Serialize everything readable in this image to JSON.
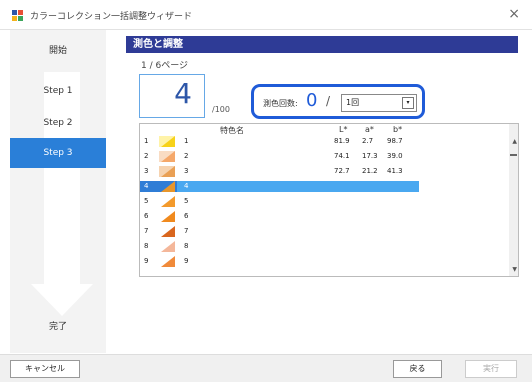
{
  "window": {
    "title": "カラーコレクション一括調整ウィザード",
    "close": "×"
  },
  "sidebar": {
    "steps": [
      {
        "label": "開始",
        "active": false
      },
      {
        "label": "Step 1",
        "active": false
      },
      {
        "label": "Step 2",
        "active": false
      },
      {
        "label": "Step 3",
        "active": true
      },
      {
        "label": "完了",
        "active": false
      }
    ]
  },
  "main": {
    "section_title": "測色と調整",
    "page_indicator": "1 / 6ページ",
    "current_number": "4",
    "of_total": "/100",
    "measure_label": "測色回数:",
    "measure_count": "0",
    "measure_slash": "/",
    "measure_select": "1回",
    "dropdown_glyph": "▾"
  },
  "table": {
    "headers": {
      "name": "特色名",
      "L": "L*",
      "a": "a*",
      "b": "b*"
    },
    "rows": [
      {
        "num": "1",
        "name": "1",
        "L": "81.9",
        "a": "2.7",
        "b": "98.7",
        "color": "#f7d21a",
        "tri": "#fff3a8"
      },
      {
        "num": "2",
        "name": "2",
        "L": "74.1",
        "a": "17.3",
        "b": "39.0",
        "color": "#f5a86a",
        "tri": "#f9dcc3"
      },
      {
        "num": "3",
        "name": "3",
        "L": "72.7",
        "a": "21.2",
        "b": "41.3",
        "color": "#e9a055",
        "tri": "#f6d3b0"
      },
      {
        "num": "4",
        "name": "4",
        "L": "",
        "a": "",
        "b": "",
        "color": "#e8962b",
        "tri": "#2f7dd6",
        "selected": true
      },
      {
        "num": "5",
        "name": "5",
        "L": "",
        "a": "",
        "b": "",
        "color": "#f39a2c",
        "tri": "#ffffff"
      },
      {
        "num": "6",
        "name": "6",
        "L": "",
        "a": "",
        "b": "",
        "color": "#f08a1e",
        "tri": "#ffffff"
      },
      {
        "num": "7",
        "name": "7",
        "L": "",
        "a": "",
        "b": "",
        "color": "#d9661e",
        "tri": "#ffffff"
      },
      {
        "num": "8",
        "name": "8",
        "L": "",
        "a": "",
        "b": "",
        "color": "#f4b79a",
        "tri": "#ffffff"
      },
      {
        "num": "9",
        "name": "9",
        "L": "",
        "a": "",
        "b": "",
        "color": "#f08a3a",
        "tri": "#ffffff"
      }
    ]
  },
  "scroll": {
    "up": "▲",
    "down": "▼"
  },
  "footer": {
    "cancel": "キャンセル",
    "back": "戻る",
    "run": "実行"
  }
}
